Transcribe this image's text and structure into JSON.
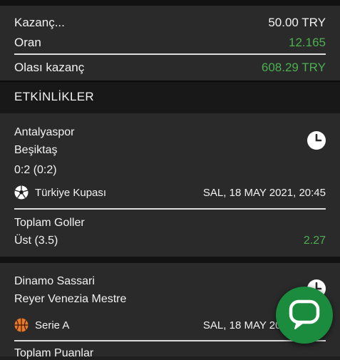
{
  "summary": {
    "stake_label": "Kazanç...",
    "stake_value": "50.00 TRY",
    "odds_label": "Oran",
    "odds_value": "12.165",
    "potential_label": "Olası kazanç",
    "potential_value": "608.29 TRY"
  },
  "section": {
    "title": "ETKİNLİKLER"
  },
  "events": [
    {
      "home": "Antalyaspor",
      "away": "Beşiktaş",
      "score": "0:2 (0:2)",
      "sport_icon": "soccer-ball-icon",
      "league": "Türkiye Kupası",
      "datetime": "SAL, 18 MAY 2021, 20:45",
      "market": "Toplam Goller",
      "selection": "Üst (3.5)",
      "odds": "2.27"
    },
    {
      "home": "Dinamo Sassari",
      "away": "Reyer Venezia Mestre",
      "sport_icon": "basketball-icon",
      "league": "Serie A",
      "datetime": "SAL, 18 MAY 2021, 20:45",
      "market": "Toplam Puanlar"
    }
  ],
  "colors": {
    "accent_green": "#4caf50",
    "chat_button": "#1b8c3e"
  },
  "icons": {
    "status": "clock-icon",
    "chat": "chat-bubble-icon"
  }
}
